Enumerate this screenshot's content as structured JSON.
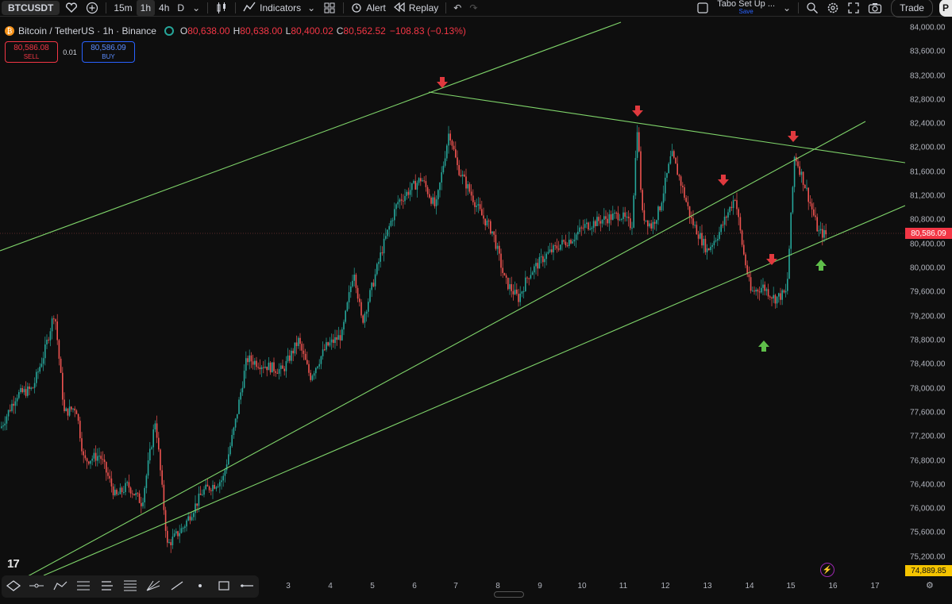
{
  "toolbar": {
    "symbol": "BTCUSDT",
    "intervals": [
      "15m",
      "1h",
      "4h",
      "D"
    ],
    "active_interval": "1h",
    "indicators_label": "Indicators",
    "alert_label": "Alert",
    "replay_label": "Replay",
    "layout_name": "Tabo Set Up ...",
    "save_label": "Save",
    "trade_label": "Trade",
    "publish_label": "P"
  },
  "legend": {
    "btc_glyph": "₿",
    "title": "Bitcoin / TetherUS · 1h · Binance",
    "open_label": "O",
    "open": "80,638.00",
    "high_label": "H",
    "high": "80,638.00",
    "low_label": "L",
    "low": "80,400.02",
    "close_label": "C",
    "close": "80,562.52",
    "change": "−108.83 (−0.13%)"
  },
  "order": {
    "sell_price": "80,586.08",
    "sell_label": "SELL",
    "spread": "0.01",
    "buy_price": "80,586.09",
    "buy_label": "BUY"
  },
  "price_axis": {
    "ticks": [
      "84,000.00",
      "83,600.00",
      "83,200.00",
      "82,800.00",
      "82,400.00",
      "82,000.00",
      "81,600.00",
      "81,200.00",
      "80,800.00",
      "80,400.00",
      "80,000.00",
      "79,600.00",
      "79,200.00",
      "78,800.00",
      "78,400.00",
      "78,000.00",
      "77,600.00",
      "77,200.00",
      "76,800.00",
      "76,400.00",
      "76,000.00",
      "75,600.00",
      "75,200.00"
    ],
    "current_price": "80,586.09",
    "low_tag": "74,889.85"
  },
  "time_axis": {
    "labels": [
      "3",
      "4",
      "5",
      "6",
      "7",
      "8",
      "9",
      "10",
      "11",
      "12",
      "13",
      "14",
      "15",
      "16",
      "17"
    ]
  },
  "colors": {
    "up": "#26a69a",
    "down": "#ef5350",
    "trendline": "#7fd46a",
    "arrow_down": "#e0393e",
    "arrow_up": "#5fbf4a",
    "price_tag": "#f23645",
    "low_tag": "#f5c400"
  },
  "drawing_tools": [
    "crosshair-icon",
    "trendline-icon",
    "brush-icon",
    "fib-icon",
    "pattern-icon",
    "text-icon",
    "projection-icon",
    "measure-icon",
    "dot-icon",
    "rectangle-icon",
    "horizontal-line-icon"
  ],
  "logo_text": "17"
}
